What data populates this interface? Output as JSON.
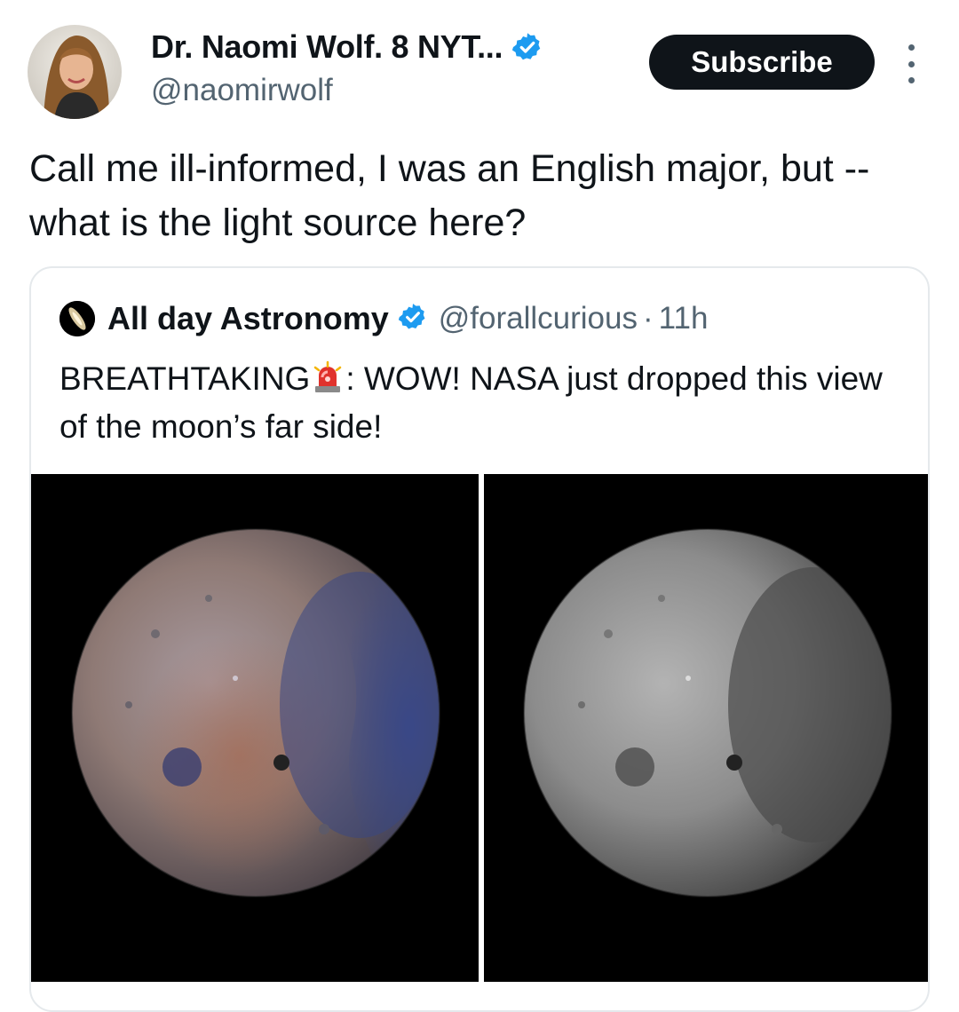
{
  "author": {
    "display_name": "Dr. Naomi Wolf. 8 NYT...",
    "handle": "@naomirwolf",
    "verified_icon": "verified-badge-icon",
    "avatar": "avatar"
  },
  "actions": {
    "subscribe_label": "Subscribe",
    "more_icon": "more-options-icon"
  },
  "tweet": {
    "text": "Call me ill-informed, I was an English major, but -- what is the light source here?"
  },
  "quoted": {
    "display_name": "All day Astronomy",
    "handle": "@forallcurious",
    "separator": "·",
    "time": "11h",
    "text_before": "BREATHTAKING",
    "text_after": ": WOW! NASA just dropped this view of the moon’s far side!",
    "images": [
      {
        "name": "moon-color-image",
        "icon": "moon-photo"
      },
      {
        "name": "moon-grayscale-image",
        "icon": "moon-photo"
      }
    ]
  },
  "colors": {
    "text": "#0f1419",
    "secondary": "#536471",
    "verified": "#1d9bf0",
    "button_bg": "#0f1419",
    "border": "#e5e9ec"
  }
}
